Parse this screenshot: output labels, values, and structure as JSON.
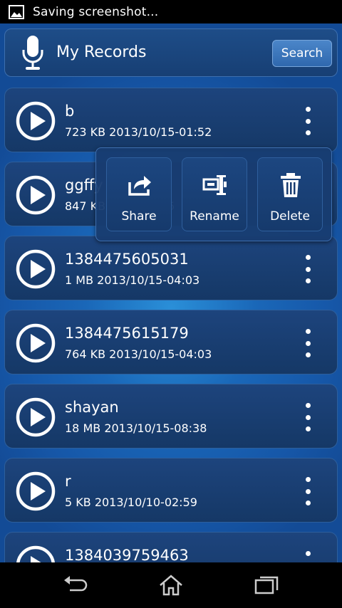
{
  "status_bar": {
    "text": "Saving screenshot...",
    "icon": "picture-icon"
  },
  "header": {
    "title": "My Records",
    "search_label": "Search",
    "icon": "microphone-icon"
  },
  "records": [
    {
      "name": "b",
      "meta": "723 KB 2013/10/15-01:52"
    },
    {
      "name": "ggffy",
      "meta": "847 KB 2013/10/15"
    },
    {
      "name": "1384475605031",
      "meta": "1 MB 2013/10/15-04:03"
    },
    {
      "name": "1384475615179",
      "meta": "764 KB 2013/10/15-04:03"
    },
    {
      "name": "shayan",
      "meta": "18 MB 2013/10/15-08:38"
    },
    {
      "name": "r",
      "meta": "5 KB 2013/10/10-02:59"
    },
    {
      "name": "1384039759463",
      "meta": ""
    }
  ],
  "popup": {
    "share_label": "Share",
    "rename_label": "Rename",
    "delete_label": "Delete"
  },
  "nav": {
    "back": "back-icon",
    "home": "home-icon",
    "recents": "recents-icon"
  },
  "colors": {
    "background": "#1a67b8",
    "row": "#1d447d",
    "accent": "#4b86c9"
  }
}
